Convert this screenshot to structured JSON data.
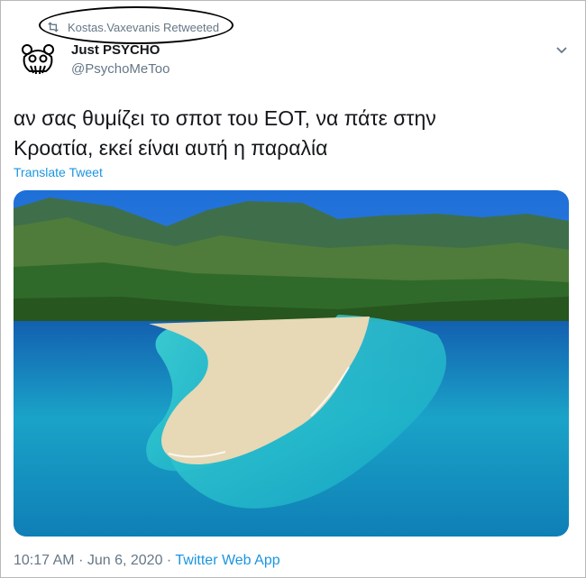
{
  "retweet": {
    "text": "Kostas.Vaxevanis Retweeted",
    "icon": "retweet-icon"
  },
  "author": {
    "display_name": "Just PSYCHO",
    "handle": "@PsychoMeToo",
    "avatar_icon": "bear-logo-icon"
  },
  "tweet": {
    "text": "αν σας θυμίζει το σποτ του ΕΟΤ, να πάτε στην\nΚροατία, εκεί είναι αυτή η παραλία",
    "translate_label": "Translate Tweet"
  },
  "footer": {
    "time": "10:17 AM",
    "separator": "·",
    "date": "Jun 6, 2020",
    "app": "Twitter Web App"
  },
  "colors": {
    "link": "#1b95e0",
    "secondary_text": "#657786",
    "primary_text": "#14171a"
  }
}
